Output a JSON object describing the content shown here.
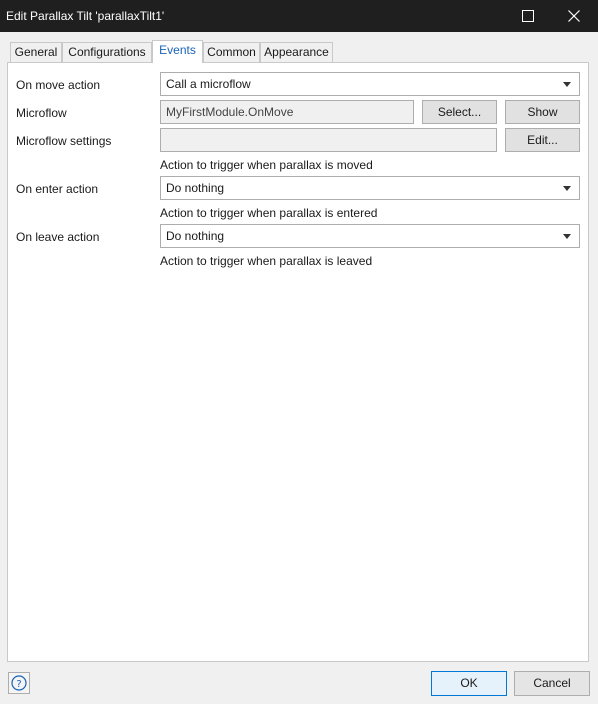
{
  "window": {
    "title": "Edit Parallax Tilt 'parallaxTilt1'"
  },
  "tabs": [
    {
      "label": "General"
    },
    {
      "label": "Configurations"
    },
    {
      "label": "Events"
    },
    {
      "label": "Common"
    },
    {
      "label": "Appearance"
    }
  ],
  "active_tab": "Events",
  "events": {
    "on_move": {
      "label": "On move action",
      "value": "Call a microflow",
      "hint": "Action to trigger when parallax is moved"
    },
    "microflow": {
      "label": "Microflow",
      "value": "MyFirstModule.OnMove",
      "select_label": "Select...",
      "show_label": "Show"
    },
    "microflow_settings": {
      "label": "Microflow settings",
      "value": "",
      "edit_label": "Edit..."
    },
    "on_enter": {
      "label": "On enter action",
      "value": "Do nothing",
      "hint": "Action to trigger when parallax is entered"
    },
    "on_leave": {
      "label": "On leave action",
      "value": "Do nothing",
      "hint": "Action to trigger when parallax is leaved"
    }
  },
  "footer": {
    "help_icon": "question-icon",
    "ok_label": "OK",
    "cancel_label": "Cancel"
  },
  "colors": {
    "titlebar_bg": "#1f1f1f",
    "active_tab_text": "#1a63b8",
    "primary_border": "#0078d7",
    "dialog_bg": "#f0f0f0"
  }
}
